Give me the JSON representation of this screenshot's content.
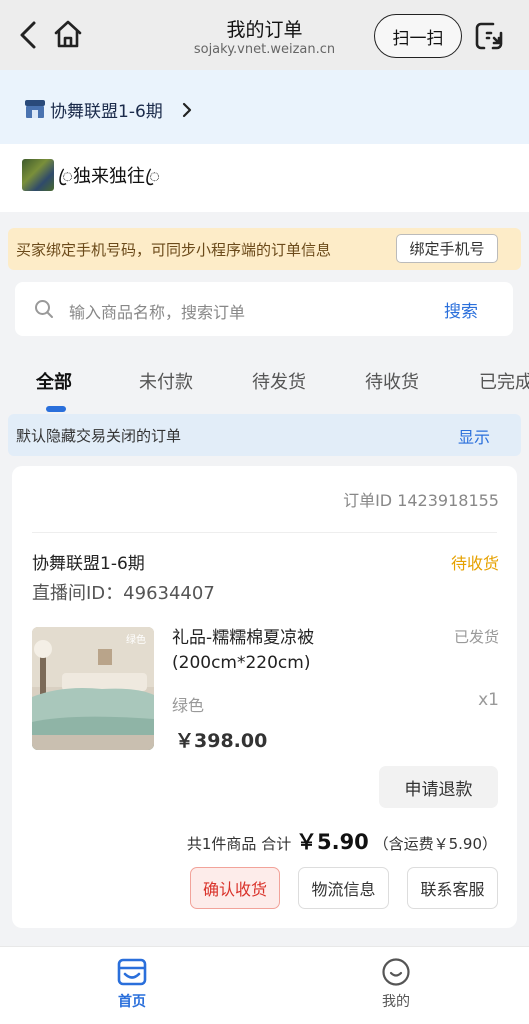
{
  "header": {
    "title": "我的订单",
    "subtitle": "sojaky.vnet.weizan.cn",
    "scan_label": "扫一扫"
  },
  "shop_bar": {
    "name": "协舞联盟1-6期"
  },
  "user": {
    "name": "ꦿ独来独往ꦿ"
  },
  "notice": {
    "text": "买家绑定手机号码，可同步小程序端的订单信息",
    "button": "绑定手机号"
  },
  "search": {
    "placeholder": "输入商品名称，搜索订单",
    "button": "搜索"
  },
  "tabs": [
    {
      "label": "全部",
      "active": true
    },
    {
      "label": "未付款",
      "active": false
    },
    {
      "label": "待发货",
      "active": false
    },
    {
      "label": "待收货",
      "active": false
    },
    {
      "label": "已完成",
      "active": false
    }
  ],
  "hidden_notice": {
    "text": "默认隐藏交易关闭的订单",
    "action": "显示"
  },
  "order": {
    "order_id": "订单ID 1423918155",
    "shop": "协舞联盟1-6期",
    "status": "待收货",
    "live_room": "直播间ID：49634407",
    "product": {
      "name": "礼品-糯糯棉夏凉被(200cm*220cm)",
      "ship_status": "已发货",
      "spec": "绿色",
      "qty": "x1",
      "price": "￥398.00",
      "thumb_tag": "绿色"
    },
    "refund_button": "申请退款",
    "total": {
      "prefix": "共1件商品 合计",
      "amount": "￥5.90",
      "shipping": "（含运费￥5.90）"
    },
    "buttons": {
      "confirm": "确认收货",
      "logistics": "物流信息",
      "service": "联系客服"
    }
  },
  "bottom_nav": {
    "home": "首页",
    "mine": "我的",
    "accent": "#2a6fdb"
  }
}
